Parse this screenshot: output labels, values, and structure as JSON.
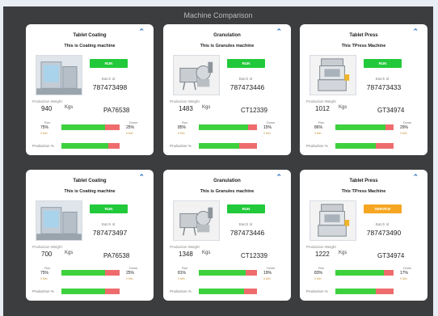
{
  "panel": {
    "title": "Machine Comparison"
  },
  "cards": [
    {
      "name": "Tablet Coating",
      "desc": "This is Coating machine",
      "machine": "coater",
      "status": "RUN",
      "status_color": "#22c93a",
      "batch_label": "Batch Id",
      "batch": "787473498",
      "pw_label": "Production Weight",
      "pw": "940",
      "pw_unit": "Kgs",
      "code": "PA76538",
      "run_label": "Run",
      "run_pct": "75%",
      "run_sub": "0 Min",
      "run_fraction": 0.75,
      "down_label": "Down",
      "down_pct": "25%",
      "down_sub": "0 Min",
      "prod_label": "Production %",
      "prod_fraction": 0.8
    },
    {
      "name": "Granulation",
      "desc": "This is Granules machine",
      "machine": "granulator",
      "status": "RUN",
      "status_color": "#22c93a",
      "batch_label": "Batch Id",
      "batch": "787473446",
      "pw_label": "Production Weight",
      "pw": "1483",
      "pw_unit": "Kgs",
      "code": "CT12339",
      "run_label": "Run",
      "run_pct": "85%",
      "run_sub": "0 Min",
      "run_fraction": 0.85,
      "down_label": "Down",
      "down_pct": "15%",
      "down_sub": "0 Min",
      "prod_label": "Production %",
      "prod_fraction": 0.7
    },
    {
      "name": "Tablet Press",
      "desc": "This TPress Machine",
      "machine": "press",
      "status": "RUN",
      "status_color": "#22c93a",
      "batch_label": "Batch Id",
      "batch": "787473433",
      "pw_label": "Production Weight",
      "pw": "1012",
      "pw_unit": "Kgs",
      "code": "GT34974",
      "run_label": "Run",
      "run_pct": "86%",
      "run_sub": "0 Min",
      "run_fraction": 0.86,
      "down_label": "Down",
      "down_pct": "29%",
      "down_sub": "0 Min",
      "prod_label": "Production %",
      "prod_fraction": 0.7
    },
    {
      "name": "Tablet Coating",
      "desc": "This is Coating machine",
      "machine": "coater",
      "status": "RUN",
      "status_color": "#22c93a",
      "batch_label": "Batch Id",
      "batch": "787473497",
      "pw_label": "Production Weight",
      "pw": "700",
      "pw_unit": "Kgs",
      "code": "PA76538",
      "run_label": "Run",
      "run_pct": "75%",
      "run_sub": "0 Min",
      "run_fraction": 0.75,
      "down_label": "Down",
      "down_pct": "25%",
      "down_sub": "0 Min",
      "prod_label": "Production %",
      "prod_fraction": 0.75
    },
    {
      "name": "Granulation",
      "desc": "This is Granules machine",
      "machine": "granulator",
      "status": "RUN",
      "status_color": "#22c93a",
      "batch_label": "Batch Id",
      "batch": "787473446",
      "pw_label": "Production Weight",
      "pw": "1348",
      "pw_unit": "Kgs",
      "code": "CT12339",
      "run_label": "Run",
      "run_pct": "81%",
      "run_sub": "0 Min",
      "run_fraction": 0.81,
      "down_label": "Down",
      "down_pct": "19%",
      "down_sub": "0 Min",
      "prod_label": "Production %",
      "prod_fraction": 0.78
    },
    {
      "name": "Tablet Press",
      "desc": "This TPress Machine",
      "machine": "press",
      "status": "SERVICE",
      "status_color": "#f5a623",
      "batch_label": "Batch Id",
      "batch": "787473490",
      "pw_label": "Production Weight",
      "pw": "1222",
      "pw_unit": "Kgs",
      "code": "GT34974",
      "run_label": "Run",
      "run_pct": "83%",
      "run_sub": "0 Min",
      "run_fraction": 0.83,
      "down_label": "Down",
      "down_pct": "17%",
      "down_sub": "0 Min",
      "prod_label": "Production %",
      "prod_fraction": 0.7
    }
  ]
}
